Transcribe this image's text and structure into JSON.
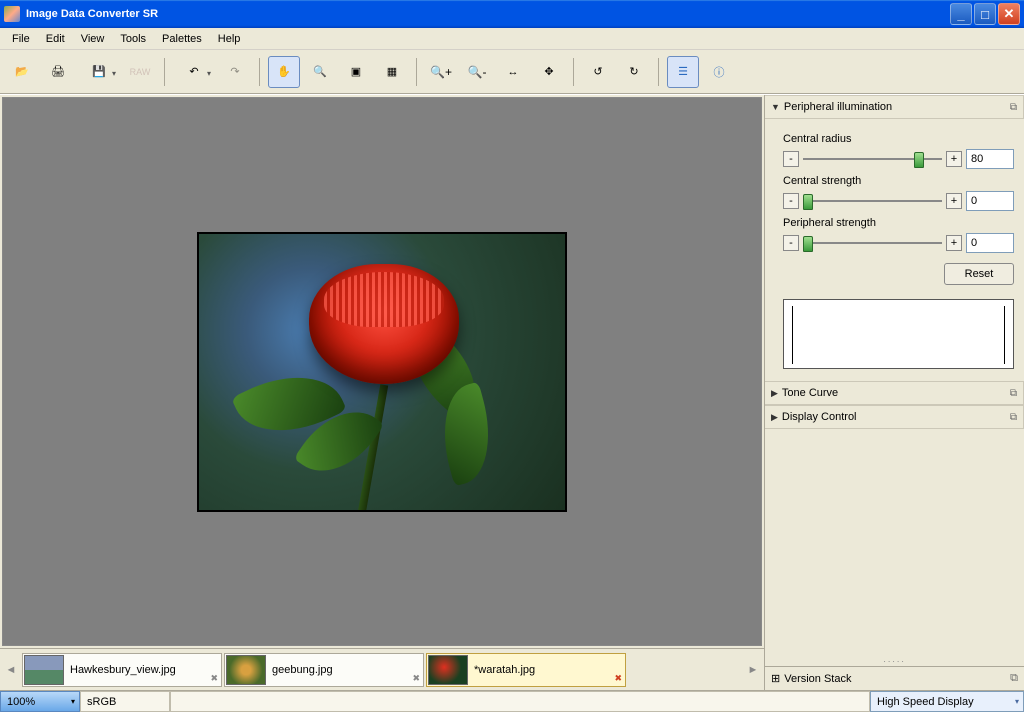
{
  "window": {
    "title": "Image Data Converter SR"
  },
  "menu": {
    "file": "File",
    "edit": "Edit",
    "view": "View",
    "tools": "Tools",
    "palettes": "Palettes",
    "help": "Help"
  },
  "toolbar": {
    "open": "📂",
    "print": "🖨",
    "save": "💾",
    "raw": "RAW",
    "undo": "↶",
    "redo": "↷",
    "pan": "✋",
    "zoom": "🔍",
    "fit": "▣",
    "grid": "▦",
    "zin": "🔍+",
    "zout": "🔍-",
    "fitw": "↔",
    "actual": "✥",
    "rotl": "↺",
    "rotr": "↻",
    "adjust": "☰",
    "info": "ⓘ"
  },
  "thumbs": [
    {
      "name": "Hawkesbury_view.jpg"
    },
    {
      "name": "geebung.jpg"
    },
    {
      "name": "*waratah.jpg"
    }
  ],
  "panel": {
    "periph_title": "Peripheral illumination",
    "central_radius_label": "Central radius",
    "central_radius_value": "80",
    "central_strength_label": "Central strength",
    "central_strength_value": "0",
    "peripheral_strength_label": "Peripheral strength",
    "peripheral_strength_value": "0",
    "reset": "Reset",
    "tone_curve": "Tone Curve",
    "display_control": "Display Control",
    "version_stack": "Version Stack"
  },
  "status": {
    "zoom": "100%",
    "colorspace": "sRGB",
    "display_mode": "High Speed Display"
  }
}
